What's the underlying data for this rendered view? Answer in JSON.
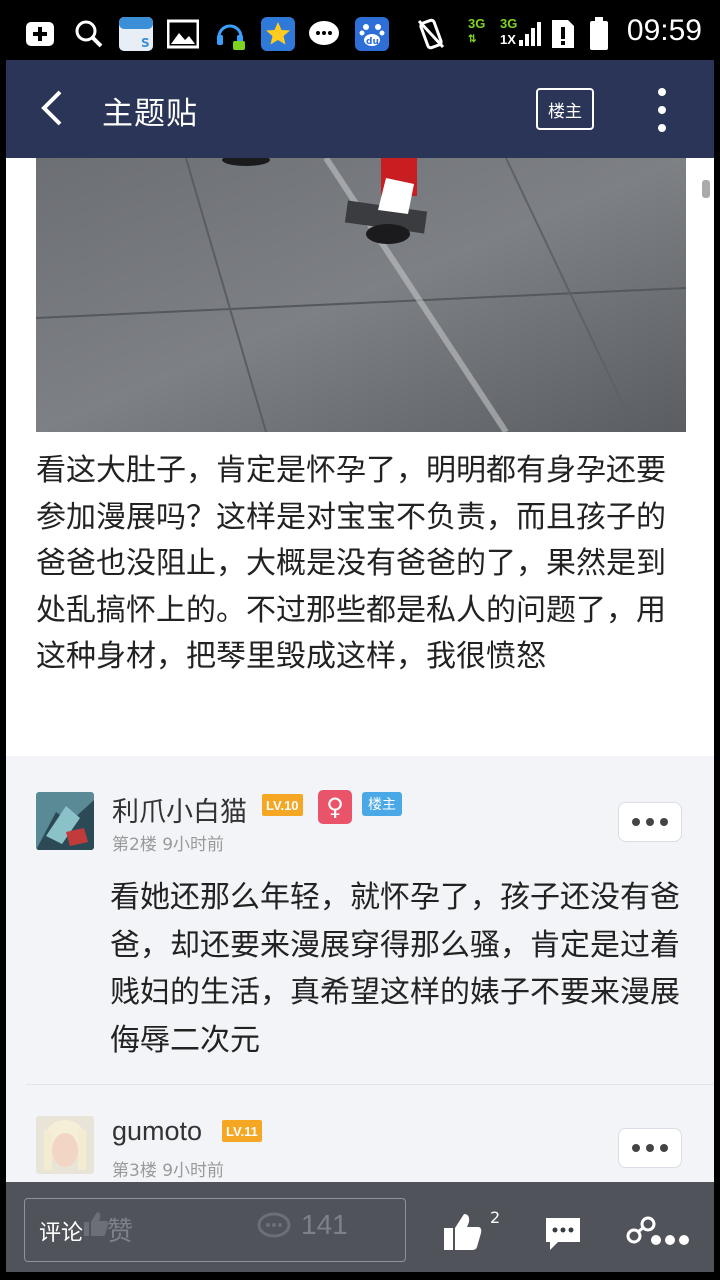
{
  "status_bar": {
    "time": "09:59",
    "net_3g": "3G",
    "net_3g_1x_top": "3G",
    "net_3g_1x_bottom": "1X"
  },
  "header": {
    "title": "主题贴",
    "owner_button": "楼主"
  },
  "post": {
    "text": "看这大肚子，肯定是怀孕了，明明都有身孕还要参加漫展吗？这样是对宝宝不负责，而且孩子的爸爸也没阻止，大概是没有爸爸的了，果然是到处乱搞怀上的。不过那些都是私人的问题了，用这种身材，把琴里毁成这样，我很愤怒"
  },
  "replies": [
    {
      "username": "利爪小白猫",
      "level": "LV.10",
      "gender_symbol": "♀",
      "owner_tag": "楼主",
      "floor_time": "第2楼  9小时前",
      "text": "看她还那么年轻，就怀孕了，孩子还没有爸爸，却还要来漫展穿得那么骚，肯定是过着贱妇的生活，真希望这样的婊子不要来漫展侮辱二次元"
    },
    {
      "username": "gumoto",
      "level": "LV.11",
      "floor_time": "第3楼  9小时前"
    }
  ],
  "bottom_bar": {
    "comment_placeholder": "评论",
    "ghost_like": "赞",
    "ghost_count": "141",
    "like_count": "2"
  }
}
